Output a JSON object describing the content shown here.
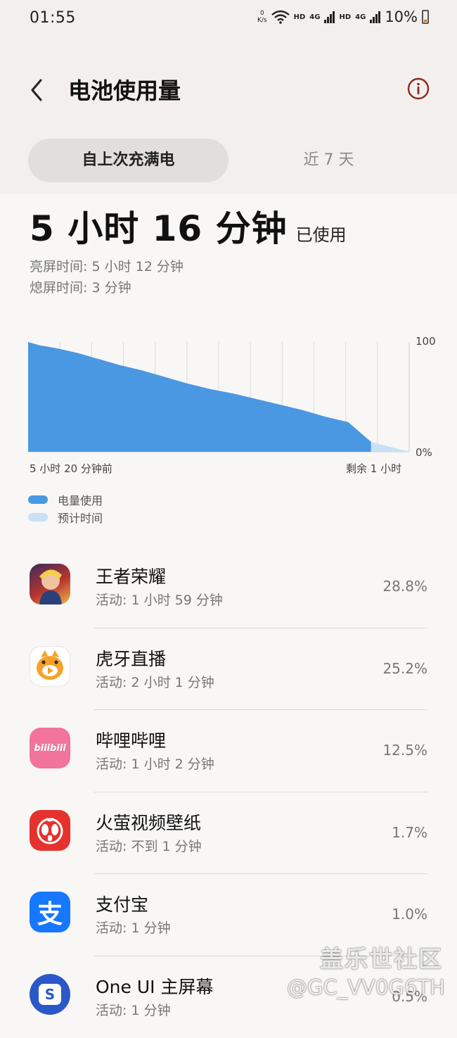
{
  "status_bar": {
    "time": "01:55",
    "net_speed_value": "0",
    "net_speed_unit": "K/s",
    "hd_1": "HD",
    "lte_1": "4G",
    "hd_2": "HD",
    "lte_2": "4G",
    "battery_percent": "10%",
    "icons": [
      "wifi-icon",
      "signal-icon",
      "battery-icon"
    ]
  },
  "header": {
    "title": "电池使用量",
    "back_icon": "chevron-left-icon",
    "info_icon": "info-icon"
  },
  "tabs": [
    {
      "label": "自上次充满电",
      "selected": true
    },
    {
      "label": "近 7 天",
      "selected": false
    }
  ],
  "summary": {
    "usage_value": "5 小时 16 分钟",
    "usage_suffix": "已使用",
    "screen_on": "亮屏时间:  5 小时 12 分钟",
    "screen_off": "熄屏时间:  3 分钟"
  },
  "chart_data": {
    "type": "area",
    "y_max_label": "100",
    "y_min_label": "0%",
    "x_start_label": "5 小时 20 分钟前",
    "x_end_label": "剩余 1 小时",
    "ylim": [
      0,
      100
    ],
    "grid": true,
    "series": [
      {
        "name": "电量使用",
        "color": "#4a97e2",
        "x": [
          0,
          0.03,
          0.08,
          0.13,
          0.18,
          0.24,
          0.3,
          0.36,
          0.42,
          0.48,
          0.54,
          0.6,
          0.66,
          0.72,
          0.78,
          0.84,
          0.9
        ],
        "values": [
          100,
          97,
          94,
          90,
          85,
          79,
          74,
          68,
          62,
          57,
          53,
          48,
          43,
          38,
          32,
          27,
          9
        ]
      },
      {
        "name": "预计时间",
        "color": "#c9e0f5",
        "x": [
          0.9,
          1.0
        ],
        "values": [
          9,
          0
        ]
      }
    ]
  },
  "legend": [
    {
      "label": "电量使用",
      "color": "#4a97e2"
    },
    {
      "label": "预计时间",
      "color": "#c9e0f5"
    }
  ],
  "apps": [
    {
      "name": "王者荣耀",
      "activity": "活动: 1 小时 59 分钟",
      "percent": "28.8%",
      "icon": "honor-of-kings-icon"
    },
    {
      "name": "虎牙直播",
      "activity": "活动: 2 小时 1 分钟",
      "percent": "25.2%",
      "icon": "huya-icon"
    },
    {
      "name": "哔哩哔哩",
      "activity": "活动: 1 小时 2 分钟",
      "percent": "12.5%",
      "icon": "bilibili-icon",
      "icon_text": "bilibili"
    },
    {
      "name": "火萤视频壁纸",
      "activity": "活动: 不到 1 分钟",
      "percent": "1.7%",
      "icon": "firefly-icon"
    },
    {
      "name": "支付宝",
      "activity": "活动: 1 分钟",
      "percent": "1.0%",
      "icon": "alipay-icon",
      "icon_text": "支"
    },
    {
      "name": "One UI 主屏幕",
      "activity": "活动: 1 分钟",
      "percent": "0.5%",
      "icon": "one-ui-home-icon",
      "icon_text": "S"
    }
  ],
  "watermark": {
    "line1": "盖乐世社区",
    "line2": "@GC_VV0G6TH"
  }
}
